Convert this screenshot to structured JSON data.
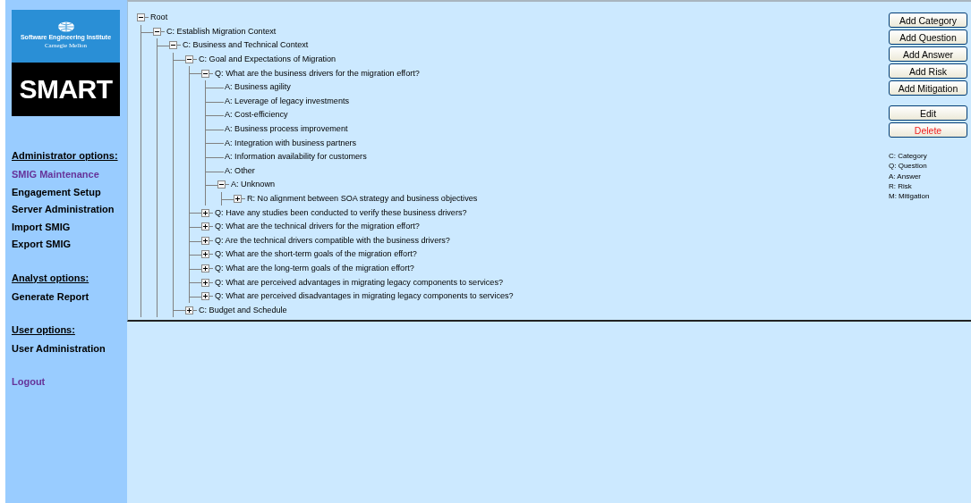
{
  "logo": {
    "institute": "Software Engineering Institute",
    "university": "Carnegie Mellon",
    "product": "SMART"
  },
  "sidebar": {
    "sections": [
      {
        "heading": "Administrator options:",
        "items": [
          {
            "label": "SMIG Maintenance",
            "visited": true
          },
          {
            "label": "Engagement Setup",
            "visited": false
          },
          {
            "label": "Server Administration",
            "visited": false
          },
          {
            "label": "Import SMIG",
            "visited": false
          },
          {
            "label": "Export SMIG",
            "visited": false
          }
        ]
      },
      {
        "heading": "Analyst options:",
        "items": [
          {
            "label": "Generate Report",
            "visited": false
          }
        ]
      },
      {
        "heading": "User options:",
        "items": [
          {
            "label": "User Administration",
            "visited": false
          }
        ]
      },
      {
        "items": [
          {
            "label": "Logout",
            "visited": true
          }
        ]
      }
    ]
  },
  "tree": {
    "label": "Root",
    "expanded": true,
    "children": [
      {
        "label": "C: Establish Migration Context",
        "expanded": true,
        "children": [
          {
            "label": "C: Business and Technical Context",
            "expanded": true,
            "children": [
              {
                "label": "C: Goal and Expectations of Migration",
                "expanded": true,
                "children": [
                  {
                    "label": "Q: What are the business drivers for the migration effort?",
                    "expanded": true,
                    "children": [
                      {
                        "label": "A: Business agility"
                      },
                      {
                        "label": "A: Leverage of legacy investments"
                      },
                      {
                        "label": "A: Cost-efficiency"
                      },
                      {
                        "label": "A: Business process improvement"
                      },
                      {
                        "label": "A: Integration with business partners"
                      },
                      {
                        "label": "A: Information availability for customers"
                      },
                      {
                        "label": "A: Other"
                      },
                      {
                        "label": "A: Unknown",
                        "expanded": true,
                        "children": [
                          {
                            "label": "R: No alignment between SOA strategy and business objectives",
                            "expanded": false
                          }
                        ]
                      }
                    ]
                  },
                  {
                    "label": "Q: Have any studies been conducted to verify these business drivers?",
                    "expanded": false
                  },
                  {
                    "label": "Q: What are the technical drivers for the migration effort?",
                    "expanded": false
                  },
                  {
                    "label": "Q: Are the technical drivers compatible with the business drivers?",
                    "expanded": false
                  },
                  {
                    "label": "Q: What are the short-term goals of the migration effort?",
                    "expanded": false
                  },
                  {
                    "label": "Q: What are the long-term goals of the migration effort?",
                    "expanded": false
                  },
                  {
                    "label": "Q: What are perceived advantages in migrating legacy components to services?",
                    "expanded": false
                  },
                  {
                    "label": "Q: What are perceived disadvantages in migrating legacy components to services?",
                    "expanded": false
                  }
                ]
              },
              {
                "label": "C: Budget and Schedule",
                "expanded": false
              }
            ]
          }
        ]
      }
    ]
  },
  "buttons": [
    {
      "label": "Add Category",
      "kind": "normal"
    },
    {
      "label": "Add Question",
      "kind": "normal"
    },
    {
      "label": "Add Answer",
      "kind": "normal"
    },
    {
      "label": "Add Risk",
      "kind": "normal"
    },
    {
      "label": "Add Mitigation",
      "kind": "normal"
    },
    {
      "label": "Edit",
      "kind": "normal"
    },
    {
      "label": "Delete",
      "kind": "danger"
    }
  ],
  "legend": [
    "C: Category",
    "Q: Question",
    "A: Answer",
    "R: Risk",
    "M: Mitigation"
  ]
}
